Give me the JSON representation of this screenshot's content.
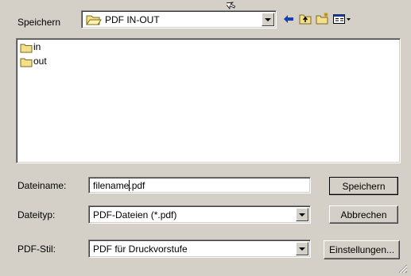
{
  "save_in": {
    "label": "Speichern",
    "current_folder": "PDF IN-OUT"
  },
  "file_list": {
    "items": [
      {
        "name": "in",
        "type": "folder"
      },
      {
        "name": "out",
        "type": "folder"
      }
    ]
  },
  "toolbar": {
    "icons": [
      "back-arrow-icon",
      "up-folder-icon",
      "new-folder-icon",
      "view-menu-icon"
    ]
  },
  "filename": {
    "label": "Dateiname:",
    "value": "filename.pdf"
  },
  "filetype": {
    "label": "Dateityp:",
    "value": "PDF-Dateien (*.pdf)"
  },
  "pdf_style": {
    "label": "PDF-Stil:",
    "value": "PDF für Druckvorstufe"
  },
  "buttons": {
    "save": "Speichern",
    "cancel": "Abbrechen",
    "settings": "Einstellungen..."
  }
}
